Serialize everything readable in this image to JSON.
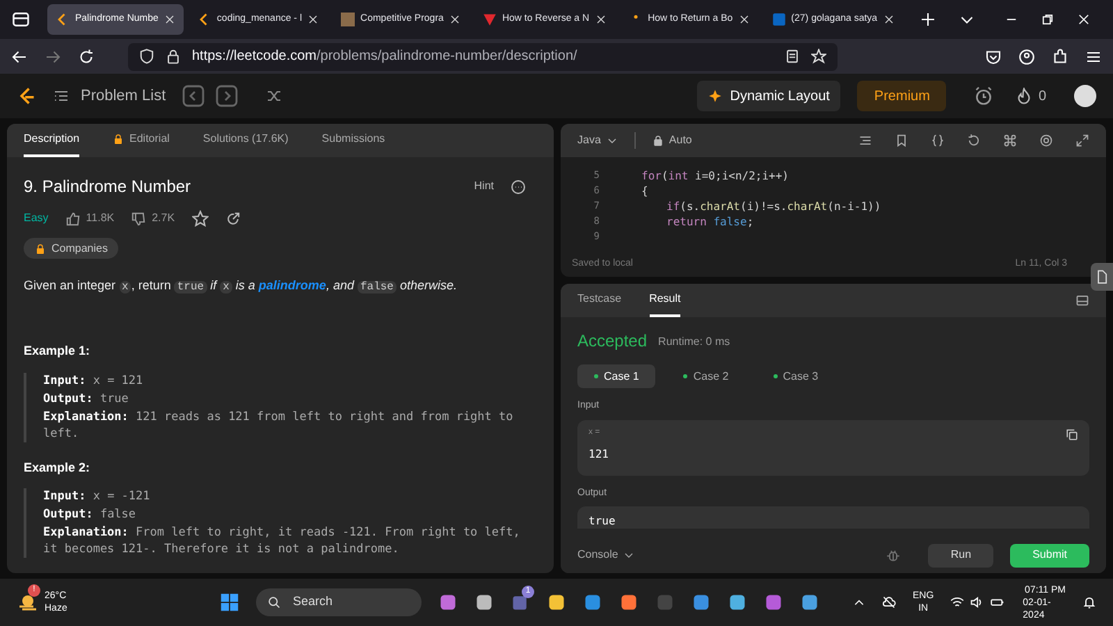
{
  "browser": {
    "tabs": [
      {
        "title": "Palindrome Numbe",
        "selected": true
      },
      {
        "title": "coding_menance - l",
        "selected": false
      },
      {
        "title": "Competitive Progra",
        "selected": false
      },
      {
        "title": "How to Reverse a N",
        "selected": false
      },
      {
        "title": "How to Return a Bo",
        "selected": false
      },
      {
        "title": "(27) golagana satya",
        "selected": false
      }
    ],
    "url_host": "https://leetcode.com",
    "url_path": "/problems/palindrome-number/description/"
  },
  "nav": {
    "problem_list": "Problem List",
    "dynamic_layout": "Dynamic Layout",
    "premium": "Premium",
    "streak": "0"
  },
  "left": {
    "tabs": [
      {
        "label": "Description",
        "selected": true,
        "locked": false
      },
      {
        "label": "Editorial",
        "selected": false,
        "locked": true
      },
      {
        "label": "Solutions (17.6K)",
        "selected": false,
        "locked": false
      },
      {
        "label": "Submissions",
        "selected": false,
        "locked": false
      }
    ],
    "title": "9. Palindrome Number",
    "hint": "Hint",
    "difficulty": "Easy",
    "likes": "11.8K",
    "dislikes": "2.7K",
    "companies": "Companies",
    "description": [
      {
        "kind": "text",
        "text": "Given an integer "
      },
      {
        "kind": "code",
        "text": "x"
      },
      {
        "kind": "text",
        "text": ", return "
      },
      {
        "kind": "code",
        "text": "true"
      },
      {
        "kind": "italic",
        "text": " if "
      },
      {
        "kind": "code",
        "text": "x"
      },
      {
        "kind": "italic",
        "text": " is a "
      },
      {
        "kind": "link",
        "text": "palindrome"
      },
      {
        "kind": "italic",
        "text": ", and "
      },
      {
        "kind": "code",
        "text": "false"
      },
      {
        "kind": "italic",
        "text": " otherwise."
      }
    ],
    "examples": [
      {
        "title": "Example 1:",
        "lines": [
          {
            "label": "Input:",
            "value": "x = 121"
          },
          {
            "label": "Output:",
            "value": "true"
          },
          {
            "label": "Explanation:",
            "value": "121 reads as 121 from left to right and from right to left."
          }
        ]
      },
      {
        "title": "Example 2:",
        "lines": [
          {
            "label": "Input:",
            "value": "x = -121"
          },
          {
            "label": "Output:",
            "value": "false"
          },
          {
            "label": "Explanation:",
            "value": "From left to right, it reads -121. From right to left, it becomes 121-. Therefore it is not a palindrome."
          }
        ]
      }
    ]
  },
  "editor": {
    "language": "Java",
    "mode": "Auto",
    "lines": [
      {
        "number": "5",
        "tokens": [
          {
            "kind": "keyword",
            "text": "for"
          },
          {
            "kind": "plain",
            "text": "("
          },
          {
            "kind": "keyword",
            "text": "int"
          },
          {
            "kind": "plain",
            "text": " i=0;i<n/2;i++)"
          }
        ]
      },
      {
        "number": "6",
        "tokens": [
          {
            "kind": "plain",
            "text": "{"
          }
        ],
        "children": [
          {
            "number": "7",
            "tokens": [
              {
                "kind": "keyword",
                "text": "if"
              },
              {
                "kind": "plain",
                "text": "(s."
              },
              {
                "kind": "method",
                "text": "charAt"
              },
              {
                "kind": "plain",
                "text": "(i)!=s."
              },
              {
                "kind": "method",
                "text": "charAt"
              },
              {
                "kind": "plain",
                "text": "(n-i-1))"
              }
            ]
          },
          {
            "number": "8",
            "tokens": [
              {
                "kind": "keyword",
                "text": "return "
              },
              {
                "kind": "literal",
                "text": "false"
              },
              {
                "kind": "plain",
                "text": ";"
              }
            ]
          }
        ]
      },
      {
        "number": "9"
      }
    ],
    "saved": "Saved to local",
    "cursor": "Ln 11, Col 3"
  },
  "result": {
    "tabs": [
      {
        "label": "Testcase",
        "selected": false
      },
      {
        "label": "Result",
        "selected": true
      }
    ],
    "status": "Accepted",
    "runtime": "Runtime: 0 ms",
    "cases": [
      {
        "label": "Case 1",
        "selected": true
      },
      {
        "label": "Case 2",
        "selected": false
      },
      {
        "label": "Case 3",
        "selected": false
      }
    ],
    "input_label": "Input",
    "input_var": "x =",
    "input_value": "121",
    "output_label": "Output",
    "output_value": "true",
    "console": "Console",
    "run": "Run",
    "submit": "Submit"
  },
  "taskbar": {
    "temperature": "26°C",
    "weather": "Haze",
    "weather_badge": "!",
    "search": "Search",
    "teams_badge": "1",
    "language": "ENG",
    "region": "IN",
    "time": "07:11 PM",
    "date": "02-01-2024"
  }
}
